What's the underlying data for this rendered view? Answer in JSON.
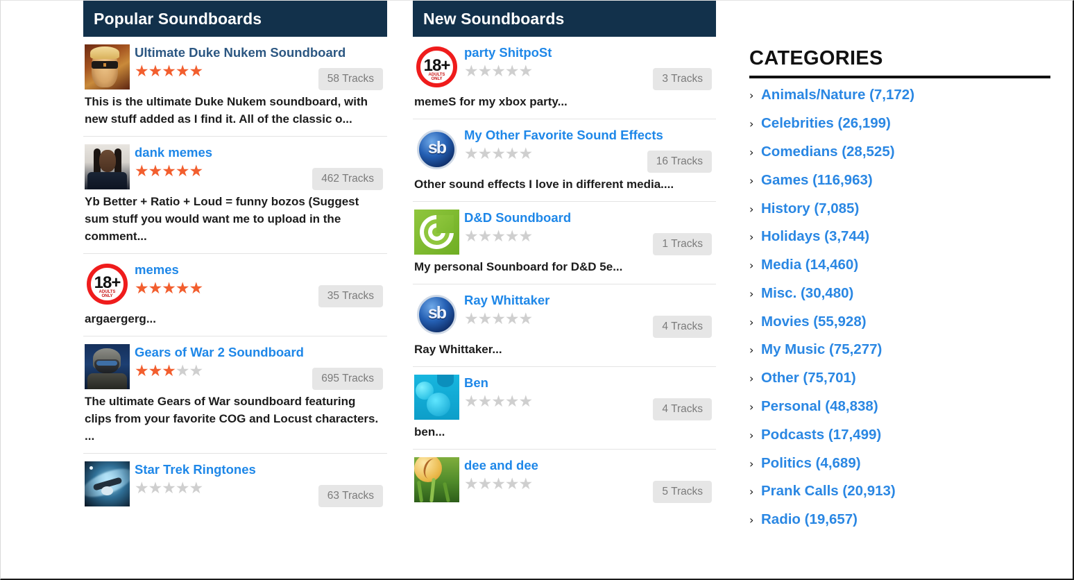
{
  "popular": {
    "header": "Popular Soundboards",
    "items": [
      {
        "title": "Ultimate Duke Nukem Soundboard",
        "title_style": "visited",
        "thumb": "duke-nukem-thumbnail",
        "rating": 5,
        "tracks": "58 Tracks",
        "description": "This is the ultimate Duke Nukem soundboard, with new stuff added as I find it. All of the classic o..."
      },
      {
        "title": "dank memes",
        "title_style": "link",
        "thumb": "snoop-dogg-thumbnail",
        "rating": 5,
        "tracks": "462 Tracks",
        "description": "Yb Better + Ratio + Loud = funny bozos (Suggest sum stuff you would want me to upload in the comment..."
      },
      {
        "title": "memes",
        "title_style": "link",
        "thumb": "adults-only-18-plus-icon",
        "rating": 5,
        "tracks": "35 Tracks",
        "description": "argaergerg..."
      },
      {
        "title": "Gears of War 2 Soundboard",
        "title_style": "link",
        "thumb": "gears-of-war-thumbnail",
        "rating": 3,
        "tracks": "695 Tracks",
        "description": "The ultimate Gears of War soundboard featuring clips from your favorite COG and Locust characters. ..."
      },
      {
        "title": "Star Trek Ringtones",
        "title_style": "link",
        "thumb": "star-trek-thumbnail",
        "rating": 0,
        "tracks": "63 Tracks",
        "description": ""
      }
    ]
  },
  "new": {
    "header": "New Soundboards",
    "items": [
      {
        "title": "party ShitpoSt",
        "title_style": "link",
        "thumb": "adults-only-18-plus-icon",
        "rating": 0,
        "tracks": "3 Tracks",
        "description": "memeS for my xbox party..."
      },
      {
        "title": "My Other Favorite Sound Effects",
        "title_style": "link",
        "thumb": "soundboard-sb-logo-icon",
        "rating": 0,
        "tracks": "16 Tracks",
        "description": "Other sound effects I love in different media...."
      },
      {
        "title": "D&D Soundboard",
        "title_style": "link",
        "thumb": "green-spiral-thumbnail",
        "rating": 0,
        "tracks": "1 Tracks",
        "description": "My personal Sounboard for D&D 5e..."
      },
      {
        "title": "Ray Whittaker",
        "title_style": "link",
        "thumb": "soundboard-sb-logo-icon",
        "rating": 0,
        "tracks": "4 Tracks",
        "description": "Ray Whittaker..."
      },
      {
        "title": "Ben",
        "title_style": "link",
        "thumb": "blue-bubbles-thumbnail",
        "rating": 0,
        "tracks": "4 Tracks",
        "description": "ben..."
      },
      {
        "title": "dee and dee",
        "title_style": "link",
        "thumb": "baseball-grass-thumbnail",
        "rating": 0,
        "tracks": "5 Tracks",
        "description": ""
      }
    ]
  },
  "sidebar": {
    "title": "CATEGORIES",
    "chevron": "›",
    "items": [
      {
        "label": "Animals/Nature (7,172)"
      },
      {
        "label": "Celebrities (26,199)"
      },
      {
        "label": "Comedians (28,525)"
      },
      {
        "label": "Games (116,963)"
      },
      {
        "label": "History (7,085)"
      },
      {
        "label": "Holidays (3,744)"
      },
      {
        "label": "Media (14,460)"
      },
      {
        "label": "Misc. (30,480)"
      },
      {
        "label": "Movies (55,928)"
      },
      {
        "label": "My Music (75,277)"
      },
      {
        "label": "Other (75,701)"
      },
      {
        "label": "Personal (48,838)"
      },
      {
        "label": "Podcasts (17,499)"
      },
      {
        "label": "Politics (4,689)"
      },
      {
        "label": "Prank Calls (20,913)"
      },
      {
        "label": "Radio (19,657)"
      }
    ]
  },
  "colors": {
    "header_bg": "#12314b",
    "link_blue": "#1e87e8",
    "visited_blue": "#2c5782",
    "star_on": "#f25e2e",
    "star_off": "#cfcfcf",
    "badge_bg": "#e6e6e6",
    "badge_text": "#7b7b7b"
  },
  "star_glyph": "★"
}
